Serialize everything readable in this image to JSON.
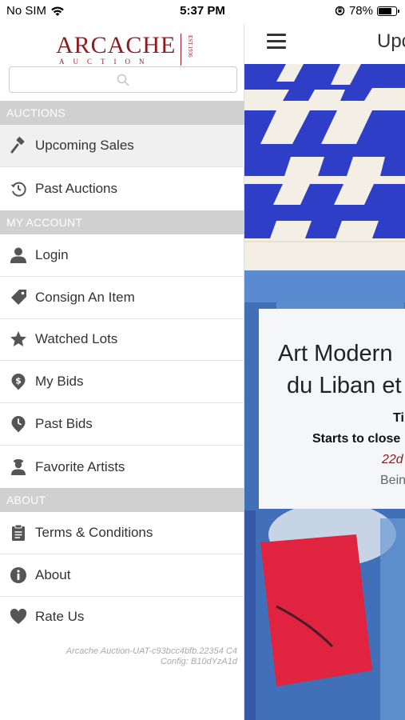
{
  "status_bar": {
    "carrier": "No SIM",
    "time": "5:37 PM",
    "battery": "78%",
    "battery_level": 0.78
  },
  "drawer": {
    "logo": {
      "brand": "ARCACHE",
      "sub": "AUCTION",
      "est": "EST.1936"
    },
    "search": {
      "placeholder": "",
      "icon": "search-icon"
    },
    "sections": {
      "auctions": "AUCTIONS",
      "my_account": "MY ACCOUNT",
      "about": "ABOUT"
    },
    "items": {
      "upcoming_sales": {
        "label": "Upcoming Sales",
        "icon": "gavel-icon"
      },
      "past_auctions": {
        "label": "Past Auctions",
        "icon": "history-icon"
      },
      "login": {
        "label": "Login",
        "icon": "user-icon"
      },
      "consign": {
        "label": "Consign An Item",
        "icon": "tag-icon"
      },
      "watched": {
        "label": "Watched Lots",
        "icon": "star-icon"
      },
      "my_bids": {
        "label": "My Bids",
        "icon": "dollar-pin-icon"
      },
      "past_bids": {
        "label": "Past Bids",
        "icon": "clock-pin-icon"
      },
      "favorite_artists": {
        "label": "Favorite Artists",
        "icon": "artist-icon"
      },
      "terms": {
        "label": "Terms & Conditions",
        "icon": "clipboard-icon"
      },
      "about": {
        "label": "About",
        "icon": "info-icon"
      },
      "rate": {
        "label": "Rate Us",
        "icon": "heart-icon"
      }
    },
    "version_line1": "Arcache Auction-UAT-c93bcc4bfb.22354 C4",
    "version_line2": "Config: B10dYzA1d"
  },
  "main": {
    "page_title": "Upc",
    "card": {
      "title_line1": "Art Modern",
      "title_line2": "du Liban et",
      "line3": "Ti",
      "line4": "Starts to close",
      "line5": "22d",
      "line6": "Bein"
    }
  }
}
